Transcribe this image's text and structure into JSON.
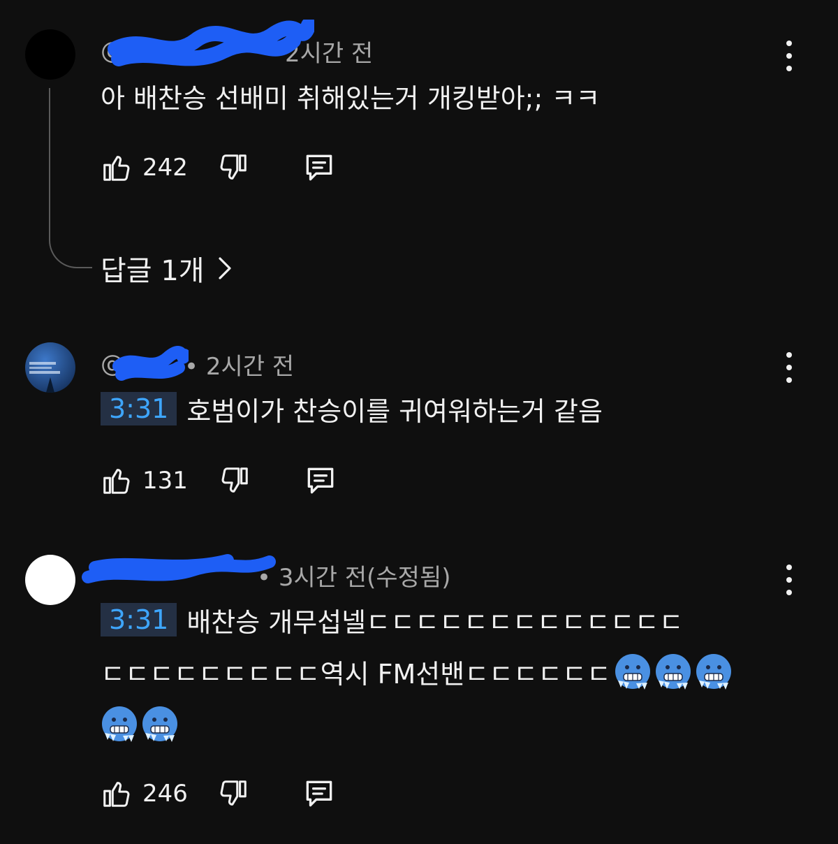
{
  "comments": [
    {
      "handle": "@",
      "time": "2시간 전",
      "text": "아 배찬승 선배미 취해있는거 개킹받아;; ㅋㅋ",
      "likes": "242",
      "replies_label": "답글 1개"
    },
    {
      "handle": "@",
      "time": "• 2시간 전",
      "timestamp": "3:31",
      "text": "호범이가 찬승이를 귀여워하는거 같음",
      "likes": "131"
    },
    {
      "handle": "",
      "time": "• 3시간 전(수정됨)",
      "timestamp": "3:31",
      "text_line1": "배찬승 개무섭넬ㄷㄷㄷㄷㄷㄷㄷㄷㄷㄷㄷㄷㄷ",
      "text_line2": "ㄷㄷㄷㄷㄷㄷㄷㄷㄷ역시 FM선밴ㄷㄷㄷㄷㄷㄷ",
      "emoji": "cold-face-emoji",
      "likes": "246"
    }
  ],
  "icons": [
    "like-icon",
    "dislike-icon",
    "reply-icon",
    "more-options-icon",
    "chevron-right-icon"
  ],
  "colors": {
    "background": "#0f0f0f",
    "text": "#f1f1f1",
    "secondary": "#a8a8a8",
    "timestamp_link": "#3ea6ff",
    "redaction": "#1e5ef5"
  }
}
